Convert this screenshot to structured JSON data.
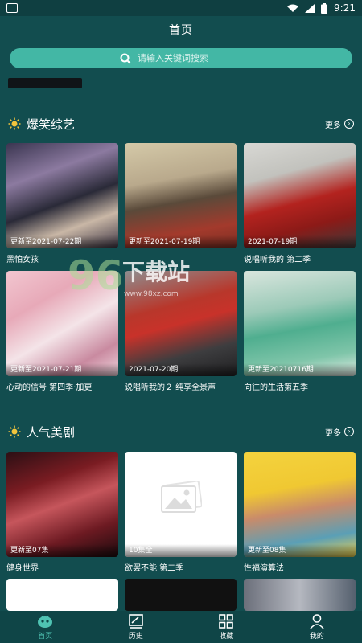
{
  "status_bar": {
    "time": "9:21"
  },
  "header": {
    "title": "首页"
  },
  "search": {
    "placeholder": "请输入关键词搜索"
  },
  "sections": [
    {
      "title": "爆笑综艺",
      "more_label": "更多",
      "items": [
        {
          "badge": "更新至2021-07-22期",
          "name": "黑怕女孩"
        },
        {
          "badge": "更新至2021-07-19期",
          "name": ""
        },
        {
          "badge": "2021-07-19期",
          "name": "说唱听我的 第二季"
        },
        {
          "badge": "更新至2021-07-21期",
          "name": "心动的信号 第四季·加更"
        },
        {
          "badge": "2021-07-20期",
          "name": "说唱听我的２ 纯享全景声"
        },
        {
          "badge": "更新至20210716期",
          "name": "向往的生活第五季"
        }
      ]
    },
    {
      "title": "人气美剧",
      "more_label": "更多",
      "items": [
        {
          "badge": "更新至07集",
          "name": "健身世界"
        },
        {
          "badge": "10集全",
          "name": "欲罢不能 第二季"
        },
        {
          "badge": "更新至08集",
          "name": "性福演算法"
        }
      ]
    }
  ],
  "watermark": {
    "text": "下载站",
    "url": "www.98xz.com",
    "num": "96"
  },
  "tabbar": [
    {
      "label": "首页",
      "icon": "home-icon",
      "active": true
    },
    {
      "label": "历史",
      "icon": "history-icon",
      "active": false
    },
    {
      "label": "收藏",
      "icon": "favorites-icon",
      "active": false
    },
    {
      "label": "我的",
      "icon": "profile-icon",
      "active": false
    }
  ],
  "colors": {
    "background": "#124d4f",
    "search_bar": "#43b7a5",
    "accent": "#4fc3b3"
  }
}
